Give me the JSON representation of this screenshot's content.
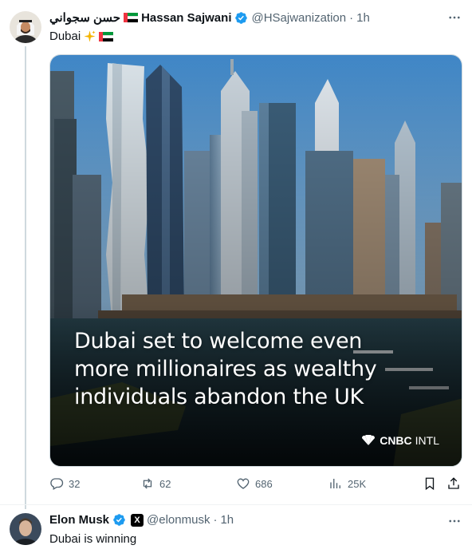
{
  "tweets": [
    {
      "display_name_ar": "حسن سجواني",
      "display_name_en": "Hassan Sajwani",
      "handle": "@HSajwanization",
      "time": "1h",
      "text": "Dubai",
      "media": {
        "headline_line1": "Dubai set to welcome even",
        "headline_line2": "more millionaires as wealthy",
        "headline_line3": "individuals abandon the UK",
        "brand_bold": "CNBC",
        "brand_regular": "INTL"
      },
      "actions": {
        "replies": "32",
        "reposts": "62",
        "likes": "686",
        "views": "25K"
      }
    },
    {
      "display_name": "Elon Musk",
      "badge_letter": "X",
      "handle": "@elonmusk",
      "time": "1h",
      "text": "Dubai is winning"
    }
  ],
  "separator": "·",
  "icons": [
    "more-icon",
    "verified-icon",
    "flag-uae-icon",
    "sparkles-icon",
    "reply-icon",
    "repost-icon",
    "like-icon",
    "views-icon",
    "bookmark-icon",
    "share-icon"
  ],
  "colors": {
    "text": "#0f1419",
    "muted": "#536471",
    "verified": "#1d9bf0",
    "border": "#cfd9de"
  }
}
